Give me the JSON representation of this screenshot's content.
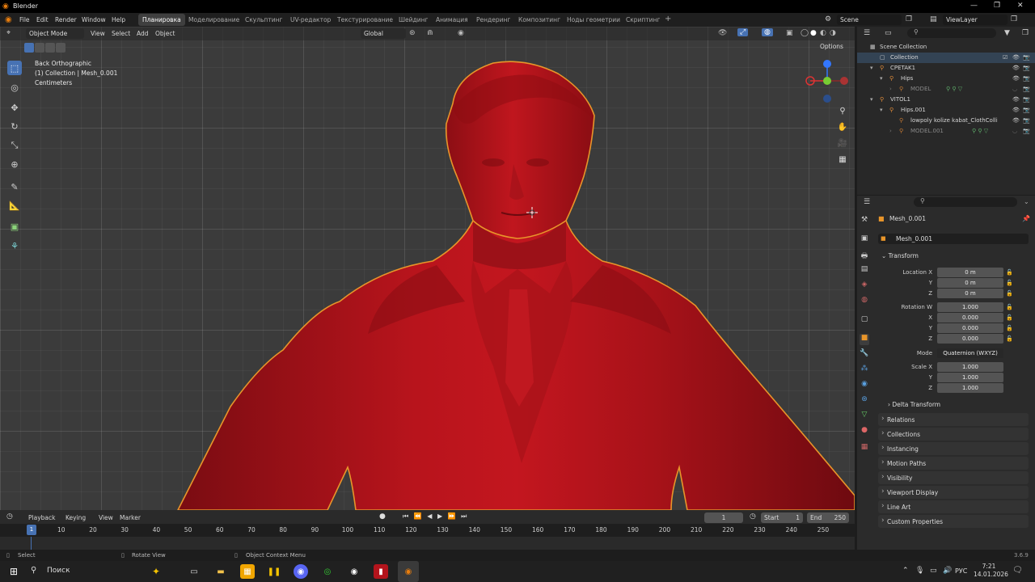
{
  "app": {
    "title": "Blender",
    "version": "3.6.9"
  },
  "menu": [
    "File",
    "Edit",
    "Render",
    "Window",
    "Help"
  ],
  "workspaces": [
    "Планировка",
    "Моделирование",
    "Скульптинг",
    "UV-редактор",
    "Текстурирование",
    "Шейдинг",
    "Анимация",
    "Рендеринг",
    "Композитинг",
    "Ноды геометрии",
    "Скриптинг"
  ],
  "active_workspace": "Планировка",
  "scene": "Scene",
  "view_layer": "ViewLayer",
  "viewport_header": {
    "mode": "Object Mode",
    "menus": [
      "View",
      "Select",
      "Add",
      "Object"
    ],
    "orientation": "Global",
    "options": "Options"
  },
  "overlay": {
    "view": "Back Orthographic",
    "collection": "(1) Collection | Mesh_0.001",
    "units": "Centimeters"
  },
  "outliner": {
    "search_placeholder": "",
    "rows": [
      {
        "label": "Scene Collection",
        "indent": 0
      },
      {
        "label": "Collection",
        "indent": 1
      },
      {
        "label": "CPETAK1",
        "indent": 1
      },
      {
        "label": "Hips",
        "indent": 2
      },
      {
        "label": "MODEL",
        "indent": 3
      },
      {
        "label": "VITOL1",
        "indent": 1
      },
      {
        "label": "Hips.001",
        "indent": 2
      },
      {
        "label": "lowpoly kolize kabat_ClothColli",
        "indent": 3
      },
      {
        "label": "MODEL.001",
        "indent": 3
      }
    ]
  },
  "properties": {
    "object_name": "Mesh_0.001",
    "object_field": "Mesh_0.001",
    "transform_label": "Transform",
    "location_label": "Location X",
    "location": [
      "0 m",
      "0 m",
      "0 m"
    ],
    "rotation_label": "Rotation W",
    "rotation": [
      "1.000",
      "0.000",
      "0.000",
      "0.000"
    ],
    "mode_label": "Mode",
    "mode": "Quaternion (WXYZ)",
    "scale_label": "Scale X",
    "scale": [
      "1.000",
      "1.000",
      "1.000"
    ],
    "axis_labels": [
      "Y",
      "Z",
      "X"
    ],
    "delta_transform": "Delta Transform",
    "panels": [
      "Relations",
      "Collections",
      "Instancing",
      "Motion Paths",
      "Visibility",
      "Viewport Display",
      "Line Art",
      "Custom Properties"
    ]
  },
  "timeline": {
    "menus": [
      "Playback",
      "Keying",
      "View",
      "Marker"
    ],
    "current_frame": "1",
    "start_label": "Start",
    "start": "1",
    "end_label": "End",
    "end": "250",
    "ticks": [
      "1",
      "10",
      "20",
      "30",
      "40",
      "50",
      "60",
      "70",
      "80",
      "90",
      "100",
      "110",
      "120",
      "130",
      "140",
      "150",
      "160",
      "170",
      "180",
      "190",
      "200",
      "210",
      "220",
      "230",
      "240",
      "250"
    ]
  },
  "status": [
    "Select",
    "Rotate View",
    "Object Context Menu"
  ],
  "taskbar": {
    "search": "Поиск",
    "time": "7:21",
    "date": "14.01.2026",
    "lang": "РУС"
  },
  "colors": {
    "model": "#b2121a",
    "outline": "#e8952a",
    "accent": "#4772b3"
  }
}
